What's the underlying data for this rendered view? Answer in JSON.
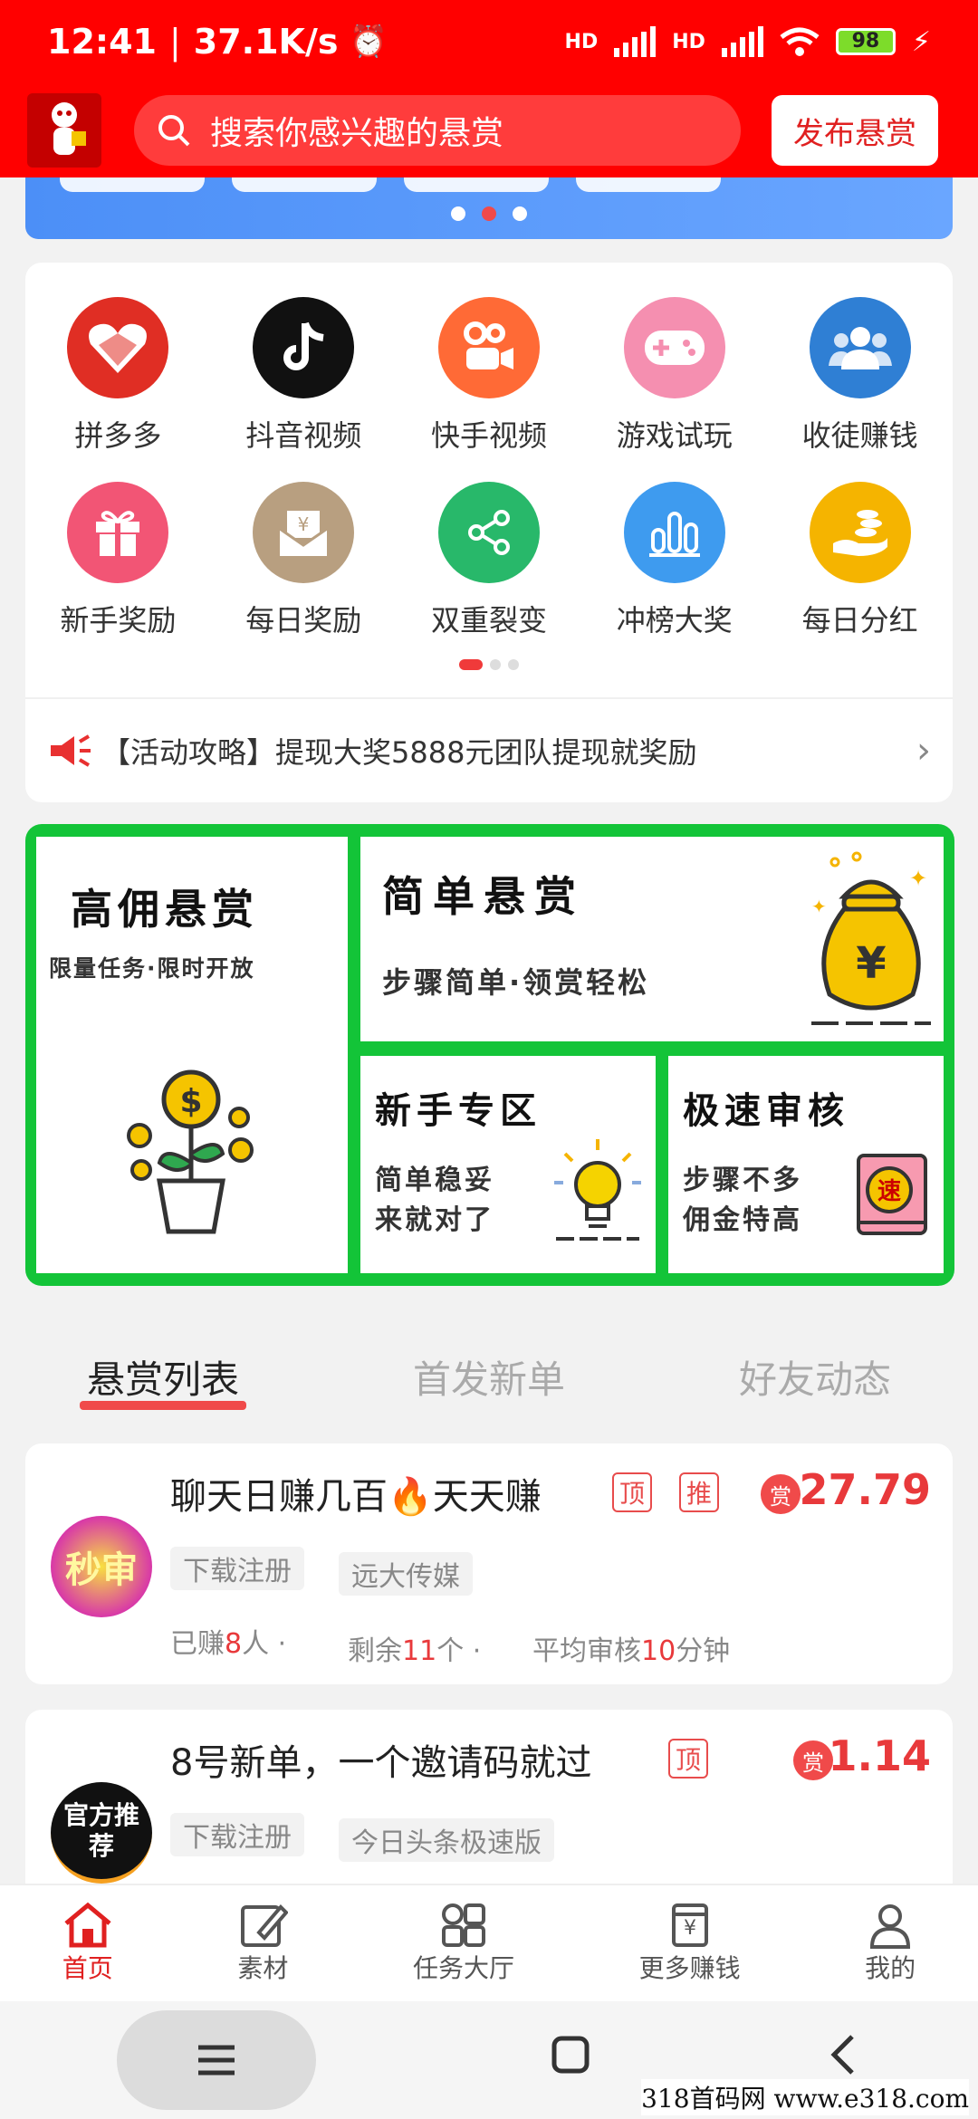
{
  "status": {
    "time": "12:41",
    "speed": "37.1K/s",
    "hd1": "HD",
    "hd2": "HD",
    "battery": "98"
  },
  "header": {
    "search_placeholder": "搜索你感兴趣的悬赏",
    "publish_label": "发布悬赏"
  },
  "grid": {
    "items": [
      {
        "label": "拼多多",
        "color": "#e02e24",
        "icon": "pinduoduo-icon"
      },
      {
        "label": "抖音视频",
        "color": "#111111",
        "icon": "douyin-icon"
      },
      {
        "label": "快手视频",
        "color": "#ff6a36",
        "icon": "kuaishou-icon"
      },
      {
        "label": "游戏试玩",
        "color": "#f58fb0",
        "icon": "gamepad-icon"
      },
      {
        "label": "收徒赚钱",
        "color": "#2f7fd4",
        "icon": "users-icon"
      },
      {
        "label": "新手奖励",
        "color": "#f25575",
        "icon": "gift-icon"
      },
      {
        "label": "每日奖励",
        "color": "#b89f80",
        "icon": "envelope-yen-icon"
      },
      {
        "label": "双重裂变",
        "color": "#28b86a",
        "icon": "share-icon"
      },
      {
        "label": "冲榜大奖",
        "color": "#3e9bef",
        "icon": "bar-chart-icon"
      },
      {
        "label": "每日分红",
        "color": "#f5b400",
        "icon": "coins-hand-icon"
      }
    ]
  },
  "notice": {
    "text": "【活动攻略】提现大奖5888元团队提现就奖励"
  },
  "promo": {
    "left_title": "高佣悬赏",
    "left_sub": "限量任务·限时开放",
    "top_title": "简单悬赏",
    "top_sub": "步骤简单·领赏轻松",
    "mid_title": "新手专区",
    "mid_sub1": "简单稳妥",
    "mid_sub2": "来就对了",
    "right_title": "极速审核",
    "right_sub1": "步骤不多",
    "right_sub2": "佣金特高",
    "money_bag_glyph": "¥",
    "speed_glyph": "速"
  },
  "tabs": [
    "悬赏列表",
    "首发新单",
    "好友动态"
  ],
  "tasks": [
    {
      "avatar": "秒审",
      "title": "聊天日赚几百🔥天天赚",
      "badges": [
        "顶",
        "推"
      ],
      "reward_icon": "赏",
      "reward": "27.79",
      "tags": [
        "下载注册",
        "远大传媒"
      ],
      "earned_prefix": "已赚",
      "earned": "8",
      "earned_suffix": "人",
      "remain_prefix": "剩余",
      "remain": "11",
      "remain_suffix": "个",
      "avg_prefix": "平均审核",
      "avg": "10",
      "avg_suffix": "分钟"
    },
    {
      "avatar": "官方推荐",
      "title": "8号新单，一个邀请码就过",
      "badges": [
        "顶"
      ],
      "reward_icon": "赏",
      "reward": "1.14",
      "tags": [
        "下载注册",
        "今日头条极速版"
      ]
    }
  ],
  "bottom_nav": [
    "首页",
    "素材",
    "任务大厅",
    "更多赚钱",
    "我的"
  ],
  "watermark": "318首码网 www.e318.com"
}
